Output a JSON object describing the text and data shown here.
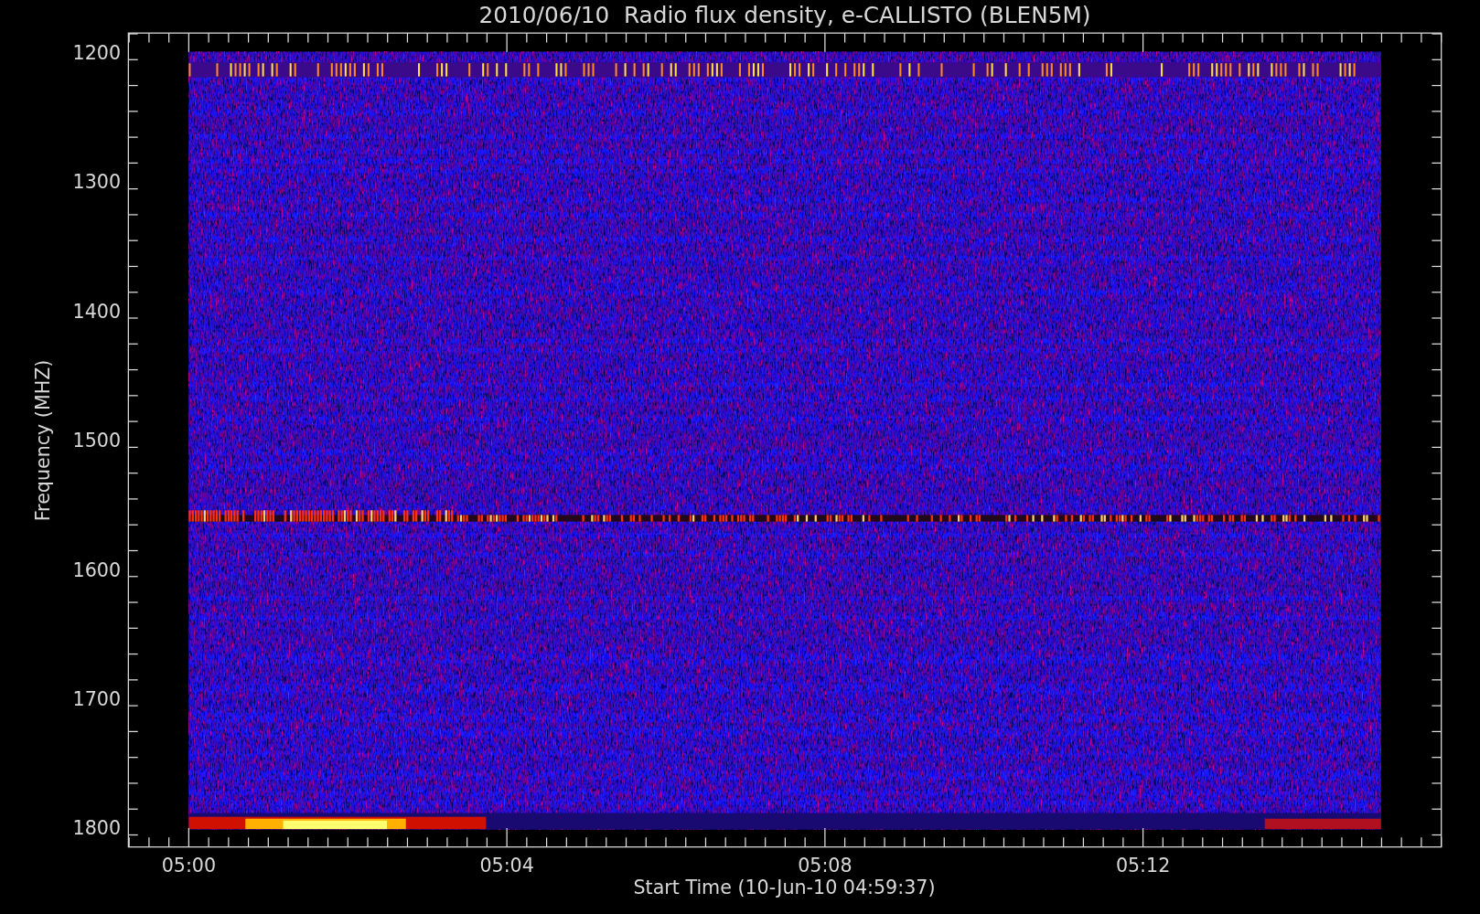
{
  "title": "2010/06/10  Radio flux density, e-CALLISTO (BLEN5M)",
  "ylabel": "Frequency (MHZ)",
  "xlabel": "Start Time (10-Jun-10 04:59:37)",
  "yticks": [
    "1200",
    "1300",
    "1400",
    "1500",
    "1600",
    "1700",
    "1800"
  ],
  "xticks": [
    "05:00",
    "05:04",
    "05:08",
    "05:12"
  ]
}
